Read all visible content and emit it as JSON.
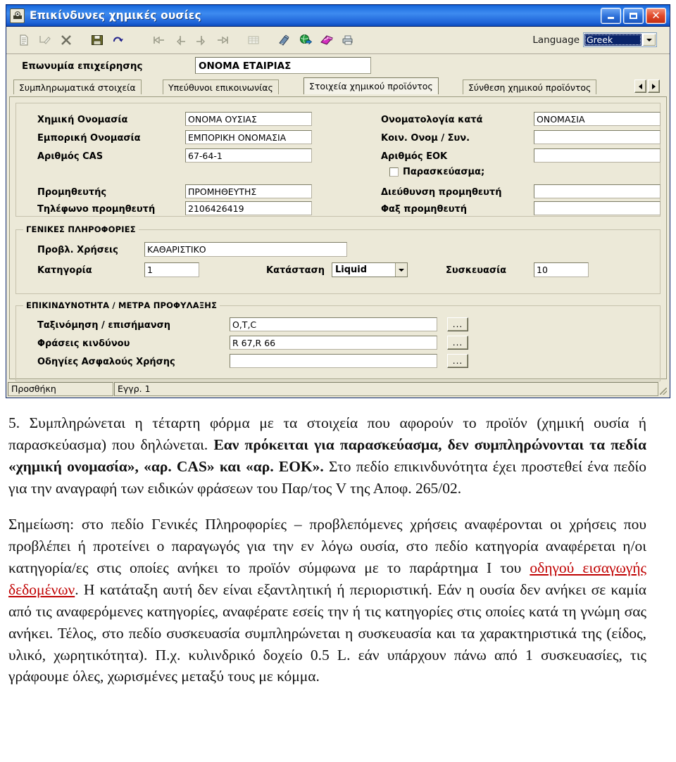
{
  "window": {
    "title": "Επικίνδυνες χημικές ουσίες",
    "icon": "hazard-app-icon",
    "buttons": {
      "minimize": "minimize-icon",
      "maximize": "maximize-icon",
      "close": "close-icon"
    }
  },
  "toolbar": {
    "icons": [
      {
        "name": "new-record-icon",
        "glyph": "document"
      },
      {
        "name": "edit-record-icon",
        "glyph": "edit"
      },
      {
        "name": "delete-record-icon",
        "glyph": "x"
      },
      {
        "name": "save-icon",
        "glyph": "floppy"
      },
      {
        "name": "refresh-icon",
        "glyph": "redo-arrow"
      },
      {
        "name": "first-record-icon",
        "glyph": "first"
      },
      {
        "name": "previous-record-icon",
        "glyph": "prev"
      },
      {
        "name": "next-record-icon",
        "glyph": "next"
      },
      {
        "name": "last-record-icon",
        "glyph": "last"
      },
      {
        "name": "grid-view-icon",
        "glyph": "grid"
      },
      {
        "name": "attachment-icon",
        "glyph": "paperclip"
      },
      {
        "name": "globe-export-icon",
        "glyph": "globe"
      },
      {
        "name": "help-book-icon",
        "glyph": "book"
      },
      {
        "name": "print-icon",
        "glyph": "printer"
      }
    ],
    "language_label": "Language",
    "language_value": "Greek",
    "dropdown_icon": "chevron-down-icon"
  },
  "company": {
    "label": "Επωνυμία επιχείρησης",
    "value": "ΟΝΟΜΑ ΕΤΑΙΡΙΑΣ"
  },
  "tabs": {
    "items": [
      {
        "label": "Συμπληρωματικά στοιχεία",
        "active": false
      },
      {
        "label": "Υπεύθυνοι επικοινωνίας",
        "active": false
      },
      {
        "label": "Στοιχεία χημικού προϊόντος",
        "active": true
      },
      {
        "label": "Σύνθεση χημικού προϊόντος",
        "active": false
      }
    ],
    "scroll_left_icon": "arrow-left-icon",
    "scroll_right_icon": "arrow-right-icon"
  },
  "identification": {
    "left": [
      {
        "label": "Χημική Ονομασία",
        "value": "ΟΝΟΜΑ ΟΥΣΙΑΣ"
      },
      {
        "label": "Εμπορική Ονομασία",
        "value": "ΕΜΠΟΡΙΚΗ ΟΝΟΜΑΣΙΑ"
      },
      {
        "label": "Αριθμός CAS",
        "value": "67-64-1"
      },
      {
        "label": "Προμηθευτής",
        "value": "ΠΡΟΜΗΘΕΥΤΗΣ"
      },
      {
        "label": "Τηλέφωνο προμηθευτή",
        "value": "2106426419"
      }
    ],
    "right": [
      {
        "label": "Ονοματολογία κατά",
        "value": "ΟΝΟΜΑΣΙΑ"
      },
      {
        "label": "Κοιν. Ονομ / Συν.",
        "value": ""
      },
      {
        "label": "Αριθμός ΕΟΚ",
        "value": ""
      },
      {
        "label": "Διεύθυνση προμηθευτή",
        "value": ""
      },
      {
        "label": "Φαξ προμηθευτή",
        "value": ""
      }
    ],
    "checkbox": {
      "label": "Παρασκεύασμα;",
      "checked": false
    }
  },
  "general_info": {
    "legend": "ΓΕΝΙΚΕΣ ΠΛΗΡΟΦΟΡΙΕΣ",
    "uses_label": "Προβλ. Χρήσεις",
    "uses_value": "ΚΑΘΑΡΙΣΤΙΚΟ",
    "category_label": "Κατηγορία",
    "category_value": "1",
    "state_label": "Κατάσταση",
    "state_value": "Liquid",
    "packaging_label": "Συσκευασία",
    "packaging_value": "10"
  },
  "hazard": {
    "legend": "ΕΠΙΚΙΝΔΥΝΟΤΗΤΑ / ΜΕΤΡΑ ΠΡΟΦΥΛΑΞΗΣ",
    "rows": [
      {
        "label": "Ταξινόμηση / επισήμανση",
        "value": "O,T,C",
        "button": "..."
      },
      {
        "label": "Φράσεις κινδύνου",
        "value": "R 67,R 66",
        "button": "..."
      },
      {
        "label": "Οδηγίες Ασφαλούς Χρήσης",
        "value": "",
        "button": "..."
      }
    ]
  },
  "status_bar": {
    "mode": "Προσθήκη",
    "record": "Εγγρ. 1"
  },
  "document": {
    "p1_a": "5. Συμπληρώνεται η τέταρτη φόρμα με τα στοιχεία που αφορούν το προϊόν (χημική ουσία ή παρασκεύασμα) που δηλώνεται. ",
    "p1_b": "Εαν πρόκειται για παρασκεύασμα, δεν συμπληρώνονται τα πεδία «χημική ονομασία», «αρ. CAS» και «αρ. ΕΟΚ».",
    "p1_c": " Στο πεδίο επικινδυνότητα έχει προστεθεί ένα πεδίο για την αναγραφή των ειδικών φράσεων του Παρ/τος V της Αποφ. 265/02.",
    "p2_a": "Σημείωση: στο πεδίο Γενικές Πληροφορίες – προβλεπόμενες χρήσεις αναφέρονται οι χρήσεις που προβλέπει ή προτείνει ο παραγωγός για την εν λόγω ουσία, στο πεδίο κατηγορία αναφέρεται η/οι κατηγορία/ες  στις οποίες ανήκει το προϊόν  σύμφωνα με το παράρτημα Ι του ",
    "p2_link": "οδηγού εισαγωγής δεδομένων",
    "p2_b": ". Η κατάταξη αυτή δεν είναι εξαντλητική ή περιοριστική. Εάν η ουσία δεν ανήκει σε καμία από τις αναφερόμενες κατηγορίες, αναφέρατε εσείς την ή τις κατηγορίες στις οποίες κατά τη γνώμη σας ανήκει. Τέλος, στο πεδίο συσκευασία συμπληρώνεται η συσκευασία και τα χαρακτηριστικά της (είδος, υλικό, χωρητικότητα). Π.χ. κυλινδρικό δοχείο 0.5 L. εάν υπάρχουν πάνω από 1 συσκευασίες, τις γράφουμε όλες, χωρισμένες μεταξύ τους με κόμμα."
  },
  "colors": {
    "title_bar": "#1f6fe0",
    "window_face": "#ece9d8",
    "selection": "#0a246a",
    "link": "#c00000",
    "close_button": "#e0492a"
  }
}
